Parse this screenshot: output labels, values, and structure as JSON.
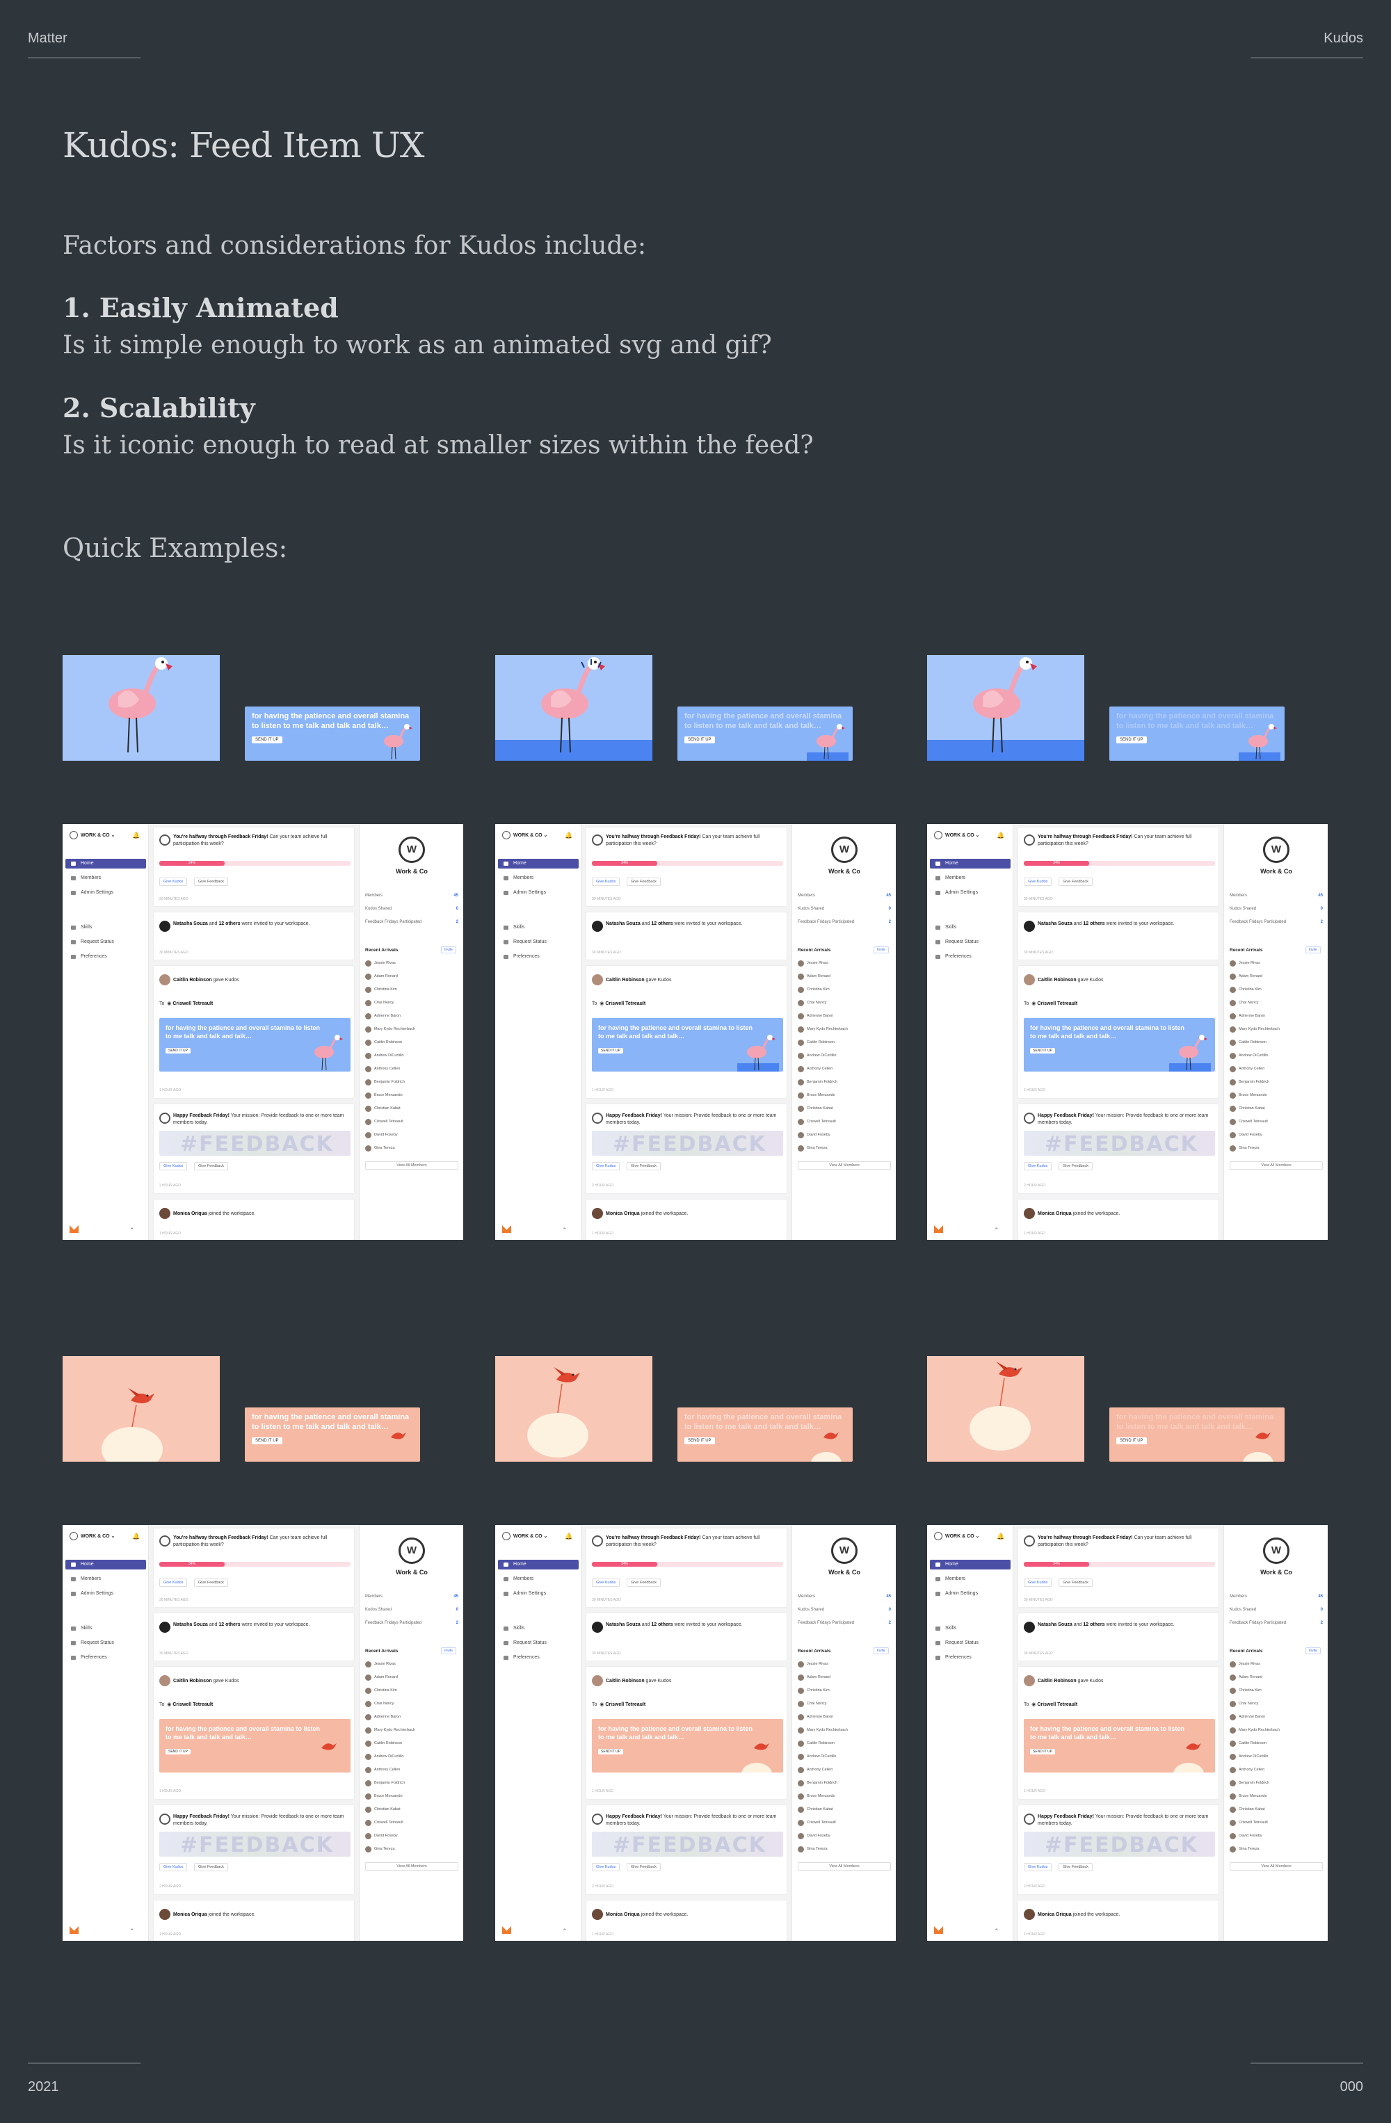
{
  "header": {
    "left": "Matter",
    "right": "Kudos"
  },
  "footer": {
    "left": "2021",
    "right": "000"
  },
  "title": "Kudos: Feed Item UX",
  "intro": "Factors and considerations for Kudos include:",
  "factors": [
    {
      "heading": "1. Easily Animated",
      "question": "Is it simple enough to work as an animated svg and gif?"
    },
    {
      "heading": "2. Scalability",
      "question": "Is it iconic enough to read at smaller sizes within the feed?"
    }
  ],
  "examples_heading": "Quick Examples:",
  "colors": {
    "background": "#2e353b",
    "blue_tile": "#a7c7fb",
    "blue_card": "#8ab4f8",
    "peach_tile": "#f8c7b6",
    "peach_card": "#f6b9a4",
    "accent": "#4b4fa6"
  },
  "kudos_card": {
    "message": "for having the patience and overall stamina to listen to me talk and talk and talk…",
    "button": "SEND IT UP"
  },
  "app": {
    "workspace_label": "WORK & CO",
    "nav": [
      "Home",
      "Members",
      "Admin Settings"
    ],
    "nav2": [
      "Skills",
      "Request Status",
      "Preferences"
    ],
    "post1": {
      "text_bold": "You're halfway through Feedback Friday!",
      "text": " Can your team achieve full participation this week?",
      "progress_label": "34%",
      "progress": 0.34,
      "btn1": "Give Kudos",
      "btn2": "Give Feedback",
      "time": "30 MINUTES AGO"
    },
    "post2": {
      "bold1": "Natasha Souza",
      "mid": " and ",
      "bold2": "12 others",
      "text": " were invited to your workspace.",
      "time": "30 MINUTES AGO"
    },
    "post3": {
      "bold": "Caitlin Robinson",
      "text": " gave Kudos",
      "to_label": "To",
      "to_name": "Criswell Tetreault",
      "time": "1 HOUR AGO"
    },
    "post4": {
      "bold": "Happy Feedback Friday!",
      "text": " Your mission: Provide feedback to one or more team members today.",
      "image_text": "#FEEDBACK FRIDAY",
      "btn1": "Give Kudos",
      "btn2": "Give Feedback",
      "time": "2 HOUR AGO"
    },
    "post5": {
      "bold": "Monica Oriqua",
      "text": " joined the workspace.",
      "time": "1 HOUR AGO"
    },
    "right": {
      "logo": "W",
      "org": "Work & Co",
      "stats": [
        {
          "label": "Members",
          "value": "45"
        },
        {
          "label": "Kudos Shared",
          "value": "0"
        },
        {
          "label": "Feedback Fridays Participated",
          "value": "2"
        }
      ],
      "recent_title": "Recent Arrivals",
      "invite": "Invite",
      "members": [
        "Jessie Rivas",
        "Adam Renard",
        "Christina Kim",
        "Chai Nancy",
        "Adrienne Baron",
        "Mary Kydo Rechterbach",
        "Caitlin Robinson",
        "Andrew DiCurtillo",
        "Anthony Cellen",
        "Benjamin Foldrich",
        "Bruce Meruando",
        "Christian Kabat",
        "Criswell Tetreault",
        "David Foseby",
        "Gina Tereza"
      ],
      "view_all": "View All Members"
    }
  }
}
